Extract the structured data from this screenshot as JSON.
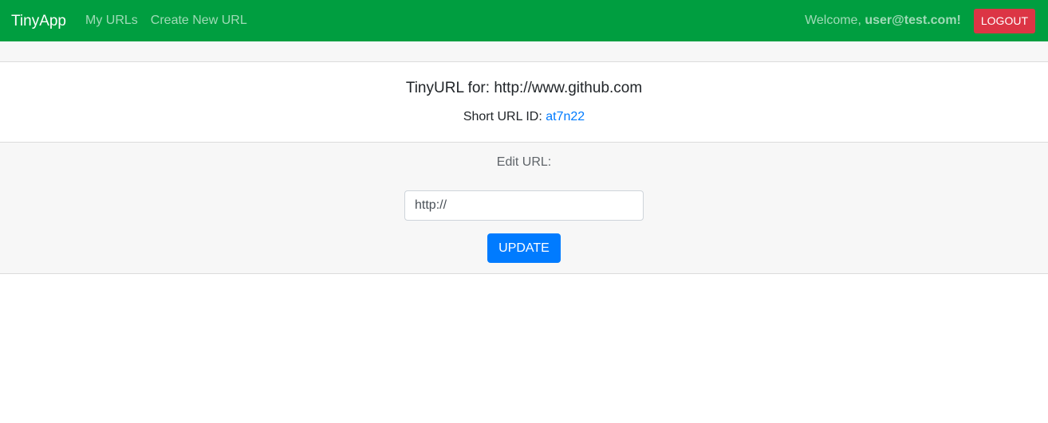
{
  "navbar": {
    "brand": "TinyApp",
    "links": [
      {
        "label": "My URLs"
      },
      {
        "label": "Create New URL"
      }
    ],
    "welcome_prefix": "Welcome, ",
    "user_email": "user@test.com!",
    "logout_label": "LOGOUT"
  },
  "card": {
    "title": "TinyURL for: http://www.github.com",
    "short_id_prefix": "Short URL ID: ",
    "short_id": "at7n22"
  },
  "edit": {
    "label": "Edit URL:",
    "input_placeholder": "http://",
    "input_value": "",
    "update_label": "UPDATE"
  },
  "colors": {
    "navbar_bg": "#009e40",
    "logout_bg": "#dc3545",
    "primary": "#007bff"
  }
}
